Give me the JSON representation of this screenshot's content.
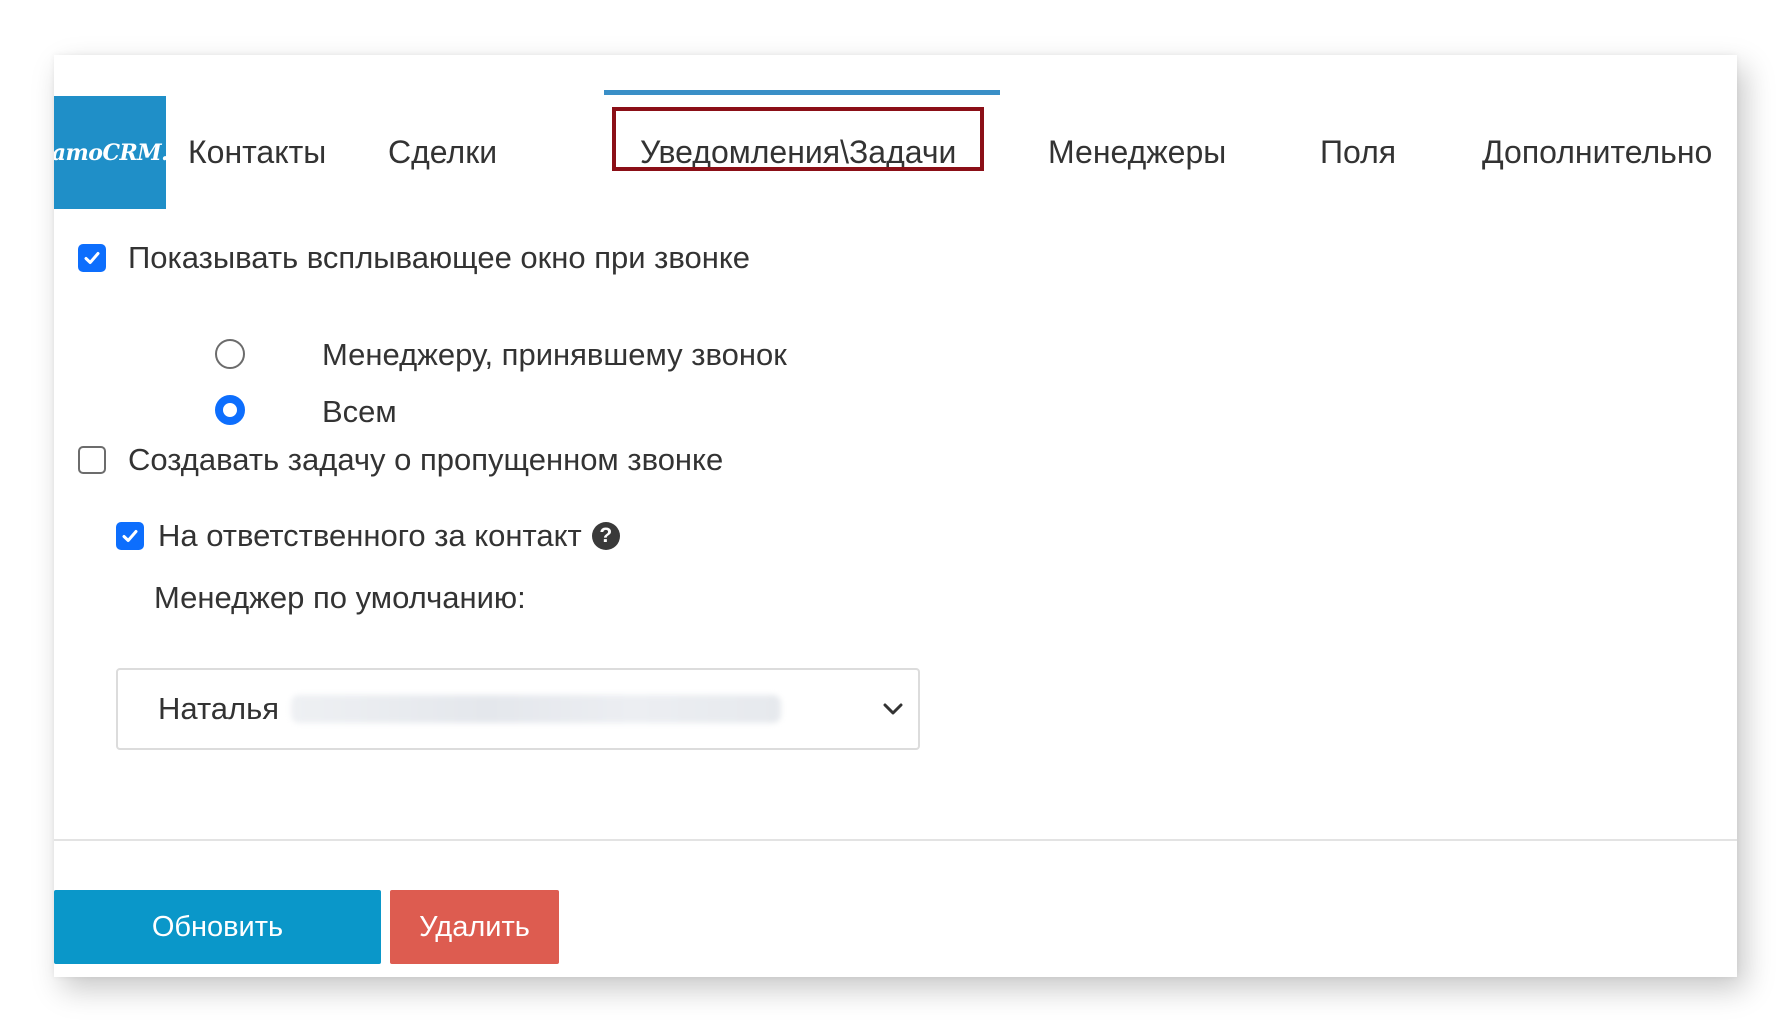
{
  "logo": {
    "text": "amoCRM."
  },
  "tabs": [
    {
      "label": "Контакты",
      "active": false
    },
    {
      "label": "Сделки",
      "active": false
    },
    {
      "label": "Уведомления\\Задачи",
      "active": true
    },
    {
      "label": "Менеджеры",
      "active": false
    },
    {
      "label": "Поля",
      "active": false
    },
    {
      "label": "Дополнительно",
      "active": false
    }
  ],
  "form": {
    "show_popup": {
      "label": "Показывать всплывающее окно при звонке",
      "checked": true
    },
    "popup_target": {
      "options": [
        {
          "label": "Менеджеру, принявшему звонок",
          "selected": false
        },
        {
          "label": "Всем",
          "selected": true
        }
      ]
    },
    "create_missed_task": {
      "label": "Создавать задачу о пропущенном звонке",
      "checked": false
    },
    "assign_to_responsible": {
      "label": "На ответственного за контакт",
      "checked": true,
      "help_icon": "question-circle-icon"
    },
    "default_manager": {
      "label": "Менеджер по умолчанию:",
      "value": "Наталья"
    }
  },
  "actions": {
    "update_label": "Обновить",
    "delete_label": "Удалить"
  },
  "colors": {
    "logo_bg": "#1f8fc8",
    "active_tab_bar": "#3a8fc7",
    "highlight_box": "#8b0f17",
    "checkbox_blue": "#0d6efd",
    "update_button": "#0a97c9",
    "delete_button": "#dd5c50"
  }
}
